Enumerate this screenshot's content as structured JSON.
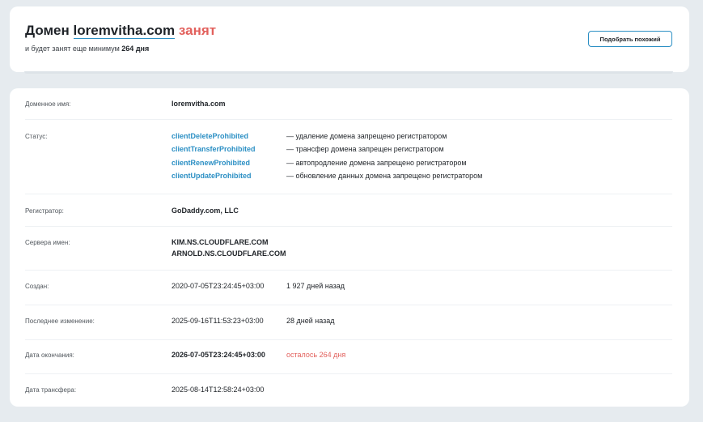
{
  "header": {
    "title_prefix": "Домен",
    "domain": "loremvitha.com",
    "status_word": "занят",
    "subtitle_prefix": "и будет занят еще минимум",
    "subtitle_days": "264 дня",
    "similar_button": "Подобрать похожий"
  },
  "details": {
    "domain_name": {
      "label": "Доменное имя:",
      "value": "loremvitha.com"
    },
    "status": {
      "label": "Статус:",
      "items": [
        {
          "code": "clientDeleteProhibited",
          "desc": "— удаление домена запрещено регистратором"
        },
        {
          "code": "clientTransferProhibited",
          "desc": "— трансфер домена запрещен регистратором"
        },
        {
          "code": "clientRenewProhibited",
          "desc": "— автопродление домена запрещено регистратором"
        },
        {
          "code": "clientUpdateProhibited",
          "desc": "— обновление данных домена запрещено регистратором"
        }
      ]
    },
    "registrar": {
      "label": "Регистратор:",
      "value": "GoDaddy.com, LLC"
    },
    "nameservers": {
      "label": "Сервера имен:",
      "values": [
        "KIM.NS.CLOUDFLARE.COM",
        "ARNOLD.NS.CLOUDFLARE.COM"
      ]
    },
    "created": {
      "label": "Создан:",
      "value": "2020-07-05T23:24:45+03:00",
      "extra": "1 927 дней назад"
    },
    "updated": {
      "label": "Последнее изменение:",
      "value": "2025-09-16T11:53:23+03:00",
      "extra": "28 дней назад"
    },
    "expires": {
      "label": "Дата окончания:",
      "value": "2026-07-05T23:24:45+03:00",
      "extra": "осталось 264 дня"
    },
    "transfer": {
      "label": "Дата трансфера:",
      "value": "2025-08-14T12:58:24+03:00"
    }
  },
  "colors": {
    "accent": "#2b8fc4",
    "danger": "#e2605c",
    "background": "#e6ebef"
  }
}
